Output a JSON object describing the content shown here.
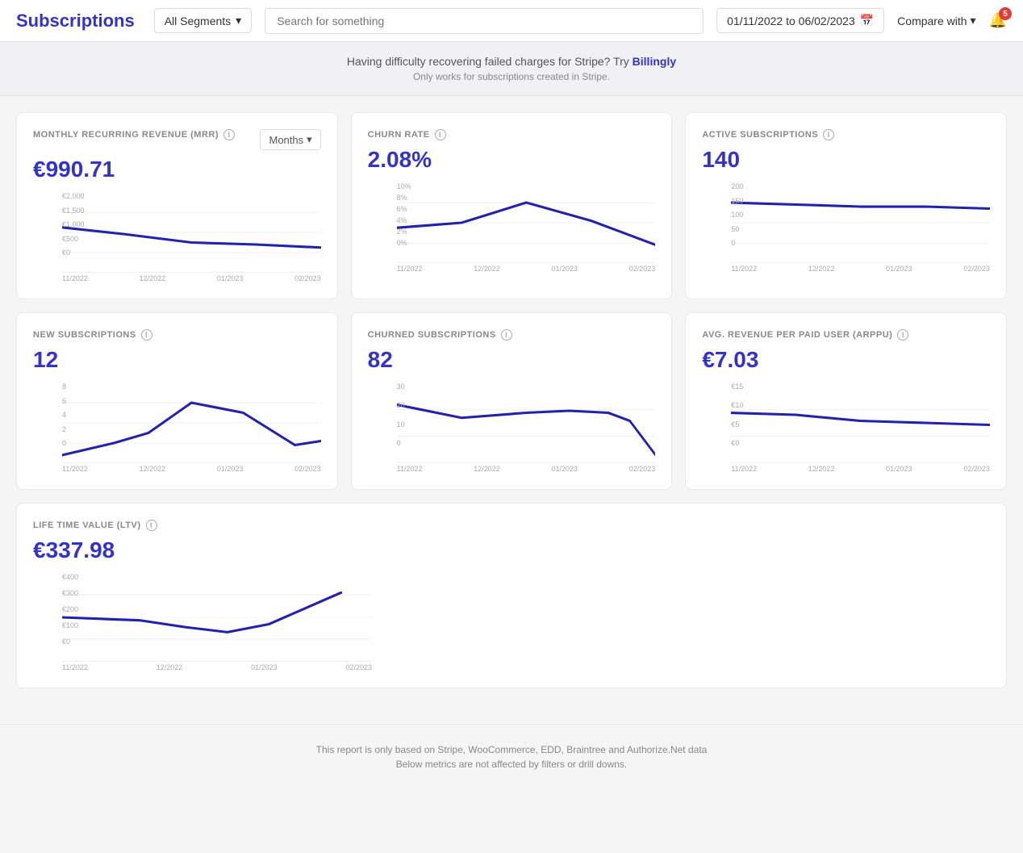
{
  "header": {
    "title": "Subscriptions",
    "segment_label": "All Segments",
    "search_placeholder": "Search for something",
    "date_range": "01/11/2022  to  06/02/2023",
    "compare_label": "Compare with",
    "notif_count": "5"
  },
  "banner": {
    "text": "Having difficulty recovering failed charges for Stripe? Try ",
    "link_text": "Billingly",
    "sub_text": "Only works for subscriptions created in Stripe."
  },
  "cards": {
    "mrr": {
      "label": "MONTHLY RECURRING REVENUE (MRR)",
      "value": "€990.71",
      "months_label": "Months",
      "y_labels": [
        "€2,000",
        "€1,500",
        "€1,000",
        "€500",
        "€0"
      ],
      "x_labels": [
        "11/2022",
        "12/2022",
        "01/2023",
        "02/2023"
      ]
    },
    "churn": {
      "label": "CHURN RATE",
      "value": "2.08%",
      "y_labels": [
        "10%",
        "8%",
        "6%",
        "4%",
        "2%",
        "0%"
      ],
      "x_labels": [
        "11/2022",
        "12/2022",
        "01/2023",
        "02/2023"
      ]
    },
    "active": {
      "label": "ACTIVE SUBSCRIPTIONS",
      "value": "140",
      "y_labels": [
        "200",
        "150",
        "100",
        "50",
        "0"
      ],
      "x_labels": [
        "11/2022",
        "12/2022",
        "01/2023",
        "02/2023"
      ]
    },
    "new_subs": {
      "label": "NEW SUBSCRIPTIONS",
      "value": "12",
      "y_labels": [
        "8",
        "6",
        "4",
        "2",
        "0"
      ],
      "x_labels": [
        "11/2022",
        "12/2022",
        "01/2023",
        "02/2023"
      ]
    },
    "churned": {
      "label": "CHURNED SUBSCRIPTIONS",
      "value": "82",
      "y_labels": [
        "30",
        "20",
        "10",
        "0"
      ],
      "x_labels": [
        "11/2022",
        "12/2022",
        "01/2023",
        "02/2023"
      ]
    },
    "arppu": {
      "label": "AVG. REVENUE PER PAID USER (ARPPU)",
      "value": "€7.03",
      "y_labels": [
        "€15",
        "€10",
        "€5",
        "€0"
      ],
      "x_labels": [
        "11/2022",
        "12/2022",
        "01/2023",
        "02/2023"
      ]
    },
    "ltv": {
      "label": "LIFE TIME VALUE (LTV)",
      "value": "€337.98",
      "y_labels": [
        "€400",
        "€300",
        "€200",
        "€100",
        "€0"
      ],
      "x_labels": [
        "11/2022",
        "12/2022",
        "01/2023",
        "02/2023"
      ]
    }
  },
  "footer": {
    "line1": "This report is only based on Stripe, WooCommerce, EDD, Braintree and Authorize.Net data",
    "line2": "Below metrics are not affected by filters or drill downs."
  }
}
